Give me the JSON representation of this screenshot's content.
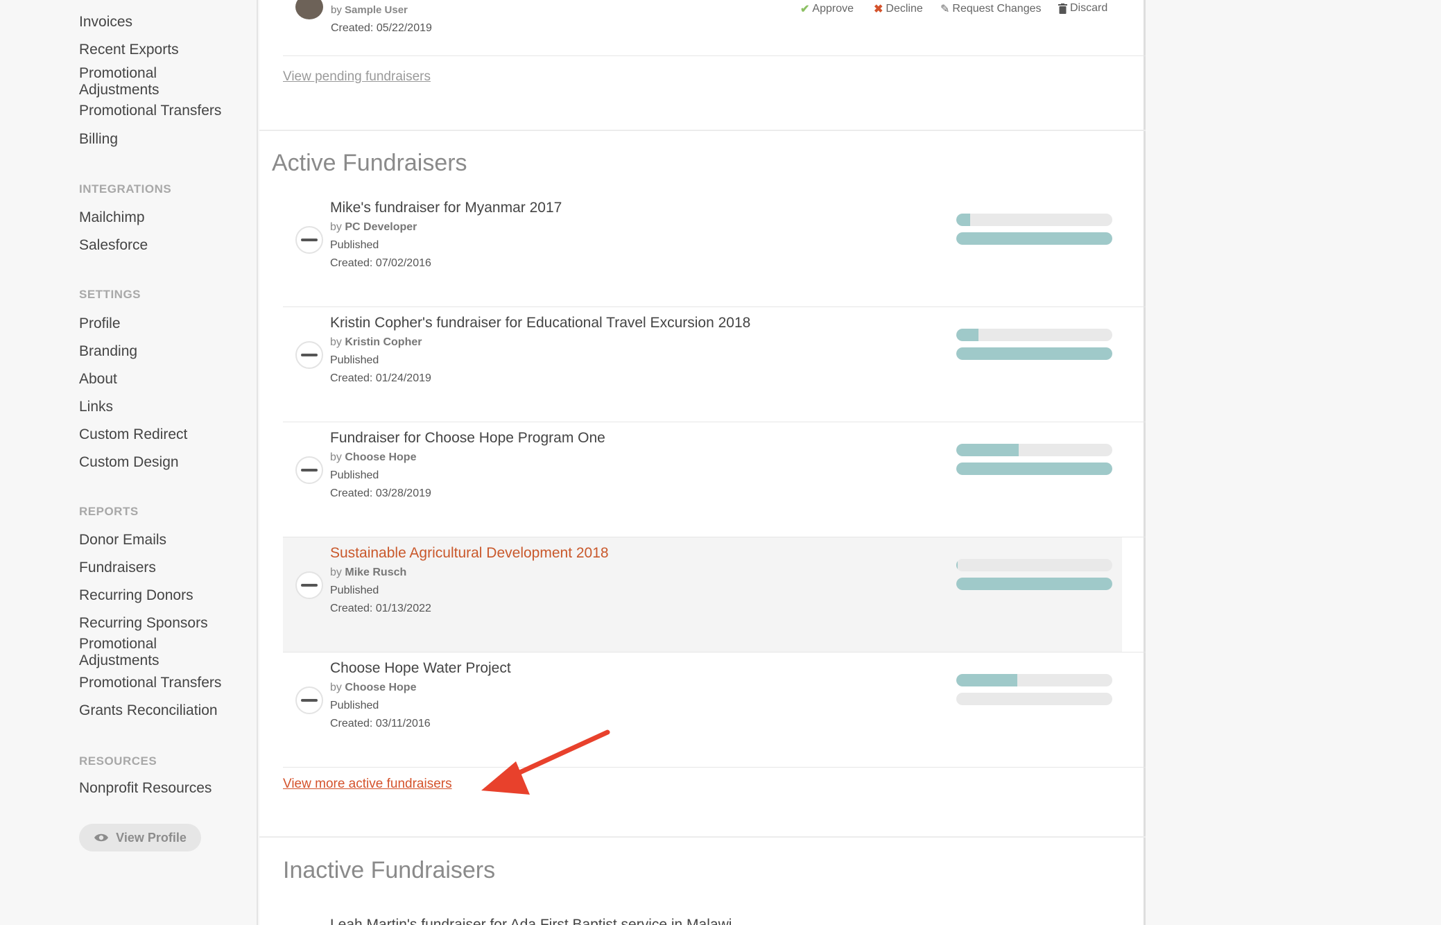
{
  "sidebar": {
    "items_top": [
      "Invoices",
      "Recent Exports",
      "Promotional Adjustments",
      "Promotional Transfers",
      "Billing"
    ],
    "integrations_heading": "INTEGRATIONS",
    "integrations": [
      "Mailchimp",
      "Salesforce"
    ],
    "settings_heading": "SETTINGS",
    "settings": [
      "Profile",
      "Branding",
      "About",
      "Links",
      "Custom Redirect",
      "Custom Design"
    ],
    "reports_heading": "REPORTS",
    "reports": [
      "Donor Emails",
      "Fundraisers",
      "Recurring Donors",
      "Recurring Sponsors",
      "Promotional Adjustments",
      "Promotional Transfers",
      "Grants Reconciliation"
    ],
    "resources_heading": "RESOURCES",
    "resources": [
      "Nonprofit Resources"
    ],
    "view_profile_label": "View Profile"
  },
  "pending": {
    "by_prefix": "by",
    "author": "Sample User",
    "created": "Created: 05/22/2019",
    "actions": {
      "approve": "Approve",
      "decline": "Decline",
      "request_changes": "Request Changes",
      "discard": "Discard"
    },
    "view_link": "View pending fundraisers"
  },
  "active": {
    "title": "Active Fundraisers",
    "view_more_link": "View more active fundraisers",
    "rows": [
      {
        "title": "Mike's fundraiser for Myanmar 2017",
        "by": "by",
        "author": "PC Developer",
        "status": "Published",
        "created": "Created: 07/02/2016",
        "progress1": 0.09,
        "progress2": 1.0,
        "highlight": false
      },
      {
        "title": "Kristin Copher's fundraiser for Educational Travel Excursion 2018",
        "by": "by",
        "author": "Kristin Copher",
        "status": "Published",
        "created": "Created: 01/24/2019",
        "progress1": 0.14,
        "progress2": 1.0,
        "highlight": false
      },
      {
        "title": "Fundraiser for Choose Hope Program One",
        "by": "by",
        "author": "Choose Hope",
        "status": "Published",
        "created": "Created: 03/28/2019",
        "progress1": 0.4,
        "progress2": 1.0,
        "highlight": false
      },
      {
        "title": "Sustainable Agricultural Development 2018",
        "by": "by",
        "author": "Mike Rusch",
        "status": "Published",
        "created": "Created: 01/13/2022",
        "progress1": 0.01,
        "progress2": 1.0,
        "highlight": true
      },
      {
        "title": "Choose Hope Water Project",
        "by": "by",
        "author": "Choose Hope",
        "status": "Published",
        "created": "Created: 03/11/2016",
        "progress1": 0.39,
        "progress2": 0.0,
        "highlight": false
      }
    ]
  },
  "inactive": {
    "title": "Inactive Fundraisers",
    "first_row_partial": "Leah Martin's fundraiser for Ada First Baptist service in Malawi"
  },
  "colors": {
    "accent_orange": "#d4532c",
    "progress_fill": "#9fc9c9",
    "annotation_arrow": "#e8412c"
  }
}
